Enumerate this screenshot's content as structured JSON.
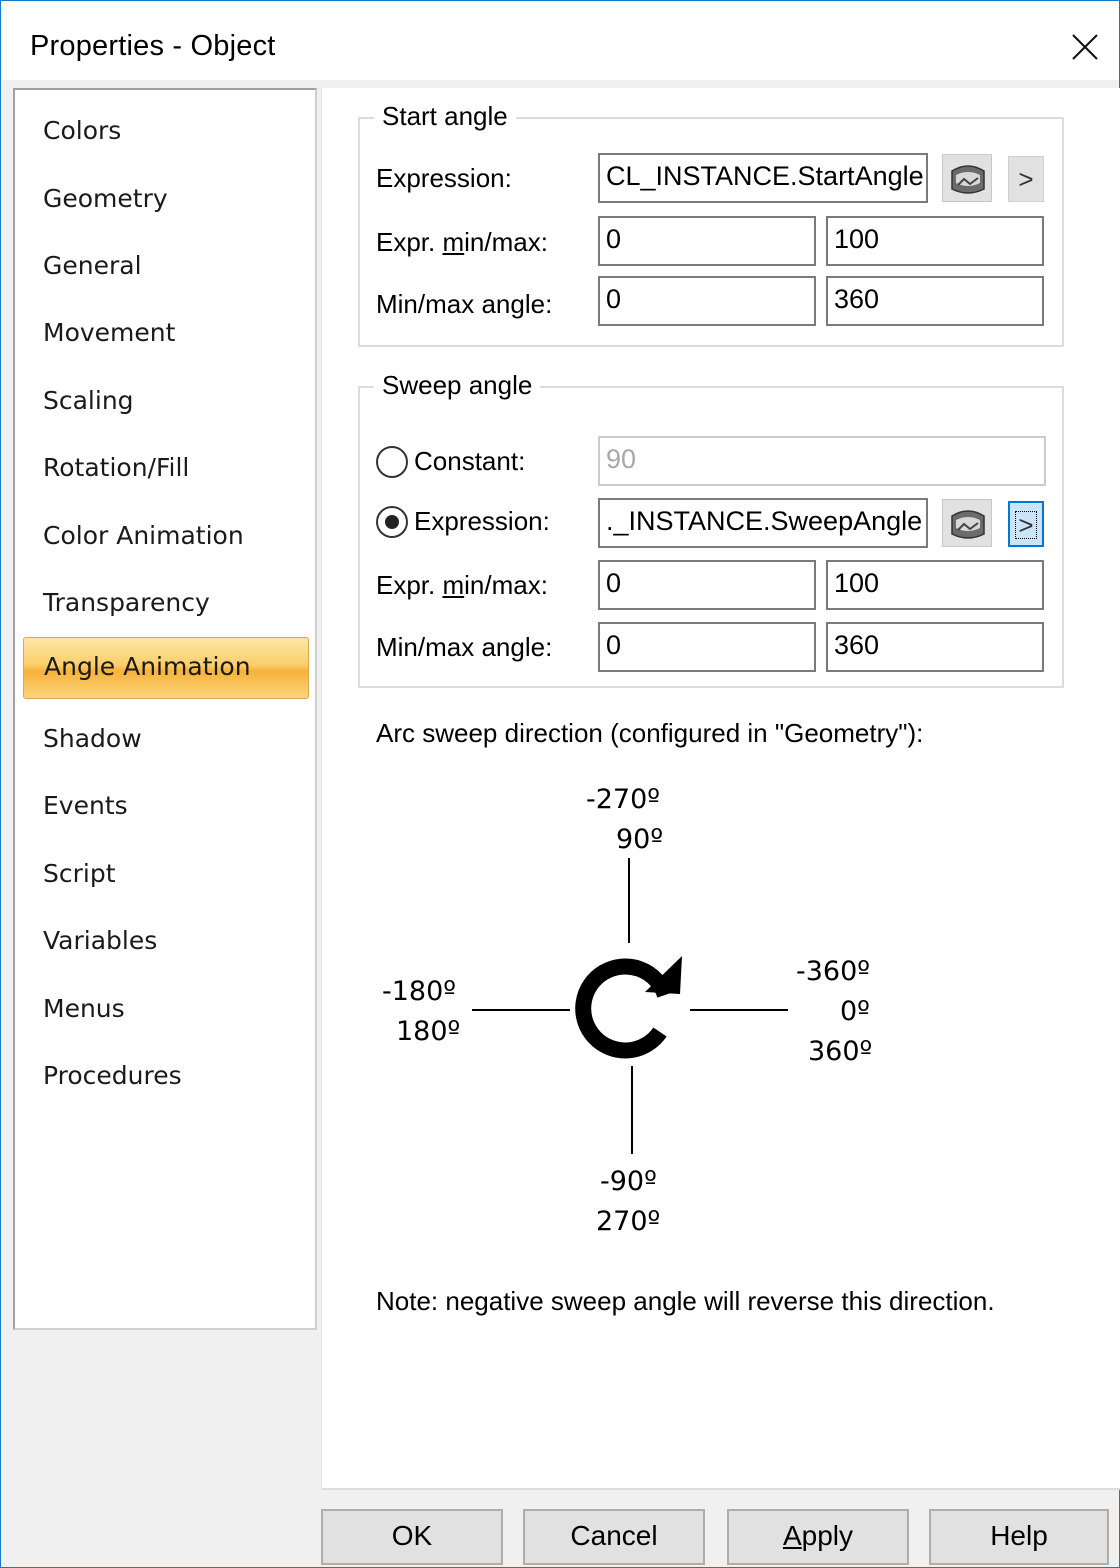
{
  "window": {
    "title": "Properties - Object"
  },
  "sidebar": {
    "items": [
      {
        "label": "Colors"
      },
      {
        "label": "Geometry"
      },
      {
        "label": "General"
      },
      {
        "label": "Movement"
      },
      {
        "label": "Scaling"
      },
      {
        "label": "Rotation/Fill"
      },
      {
        "label": "Color Animation"
      },
      {
        "label": "Transparency"
      },
      {
        "label": "Angle Animation",
        "selected": true
      },
      {
        "label": "Shadow"
      },
      {
        "label": "Events"
      },
      {
        "label": "Script"
      },
      {
        "label": "Variables"
      },
      {
        "label": "Menus"
      },
      {
        "label": "Procedures"
      }
    ]
  },
  "start_angle": {
    "title": "Start angle",
    "expression_label": "Expression:",
    "expression_value": "CL_INSTANCE.StartAngle",
    "expr_minmax_label": {
      "pre": "Expr. ",
      "accel": "m",
      "post": "in/max:"
    },
    "expr_min": "0",
    "expr_max": "100",
    "angle_minmax_label": {
      "pre": "Min/max an",
      "accel": "g",
      "post": "le:"
    },
    "angle_min": "0",
    "angle_max": "360",
    "arrow_label": ">"
  },
  "sweep_angle": {
    "title": "Sweep angle",
    "constant_label": "Constant:",
    "constant_value": "90",
    "expression_label": "Expression:",
    "expression_value": "._INSTANCE.SweepAngle",
    "selected_option": "Expression",
    "expr_minmax_label": {
      "pre": "Expr. ",
      "accel": "m",
      "post": "in/max:"
    },
    "expr_min": "0",
    "expr_max": "100",
    "angle_minmax_label": {
      "pre": "Min/max an",
      "accel": "g",
      "post": "le:"
    },
    "angle_min": "0",
    "angle_max": "360",
    "arrow_label": ">"
  },
  "diagram": {
    "caption": "Arc sweep direction (configured in \"Geometry\"):",
    "top": [
      "-270º",
      "90º"
    ],
    "left": [
      "-180º",
      "180º"
    ],
    "right": [
      "-360º",
      "0º",
      "360º"
    ],
    "bottom": [
      "-90º",
      "270º"
    ],
    "note": "Note: negative sweep angle will reverse this direction."
  },
  "buttons": {
    "ok": "OK",
    "cancel": "Cancel",
    "apply": {
      "accel": "A",
      "rest": "pply"
    },
    "help": "Help"
  },
  "colors": {
    "accent_border": "#1979ca",
    "selected_nav_gradient": [
      "#fde6a6",
      "#f7b23a"
    ],
    "focus_blue": "#0078d7"
  },
  "icons": [
    "close-icon",
    "image-browse-icon",
    "clockwise-arrow-icon"
  ]
}
